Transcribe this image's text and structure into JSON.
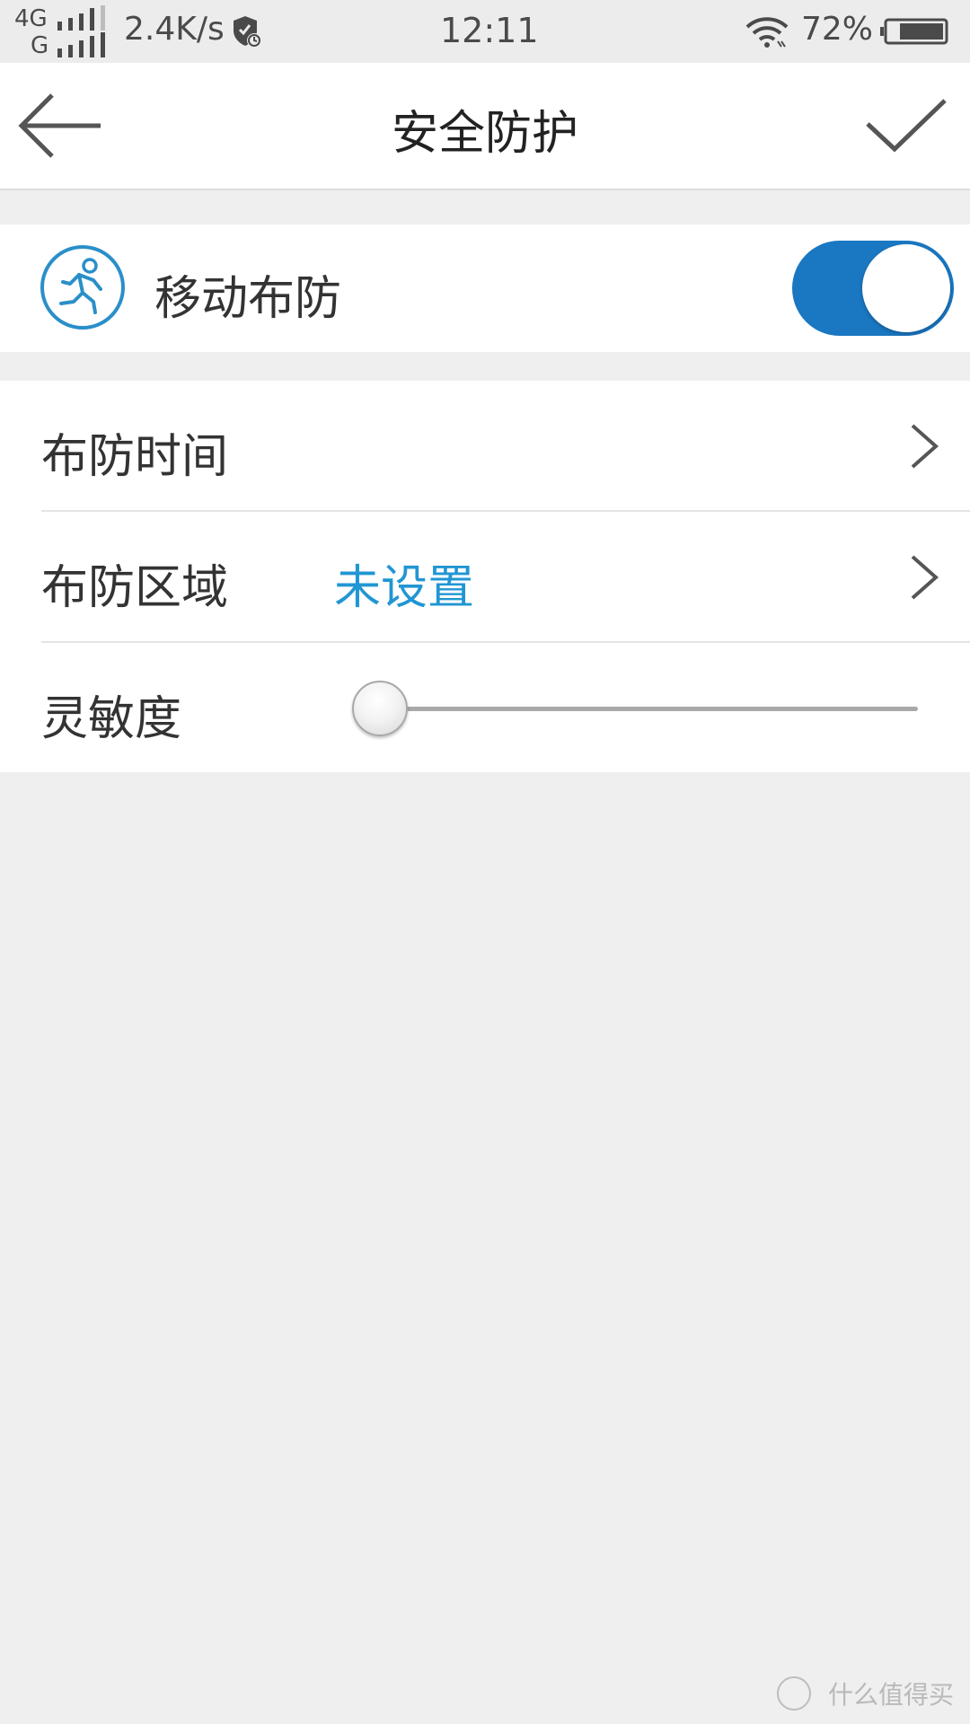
{
  "status_bar": {
    "net_top": "4G",
    "net_bottom": "G",
    "speed": "2.4K/s",
    "time": "12:11",
    "battery_percent": "72%"
  },
  "header": {
    "title": "安全防护",
    "back_icon": "arrow-left-icon",
    "confirm_icon": "check-icon"
  },
  "motion_detection": {
    "label": "移动布防",
    "icon": "running-person-icon",
    "enabled": true,
    "toggle_color": "#1a77c2"
  },
  "settings": {
    "arm_time": {
      "label": "布防时间"
    },
    "arm_area": {
      "label": "布防区域",
      "value": "未设置",
      "value_color": "#2196d3"
    },
    "sensitivity": {
      "label": "灵敏度",
      "value": 0
    }
  },
  "watermark": {
    "text": "什么值得买"
  }
}
